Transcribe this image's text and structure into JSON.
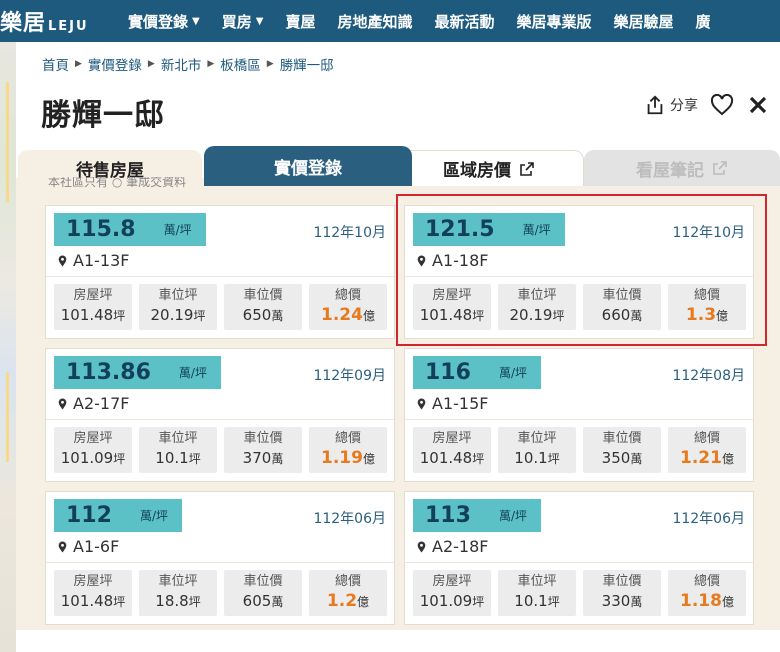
{
  "nav": {
    "logo_cn": "樂居",
    "logo_en": "LEJU",
    "items": [
      {
        "label": "實價登錄",
        "dropdown": true
      },
      {
        "label": "買房",
        "dropdown": true
      },
      {
        "label": "賣屋",
        "dropdown": false
      },
      {
        "label": "房地產知識",
        "dropdown": false
      },
      {
        "label": "最新活動",
        "dropdown": false
      },
      {
        "label": "樂居專業版",
        "dropdown": false
      },
      {
        "label": "樂居驗屋",
        "dropdown": false
      },
      {
        "label": "廣",
        "dropdown": false
      }
    ]
  },
  "breadcrumb": [
    "首頁",
    "實價登錄",
    "新北市",
    "板橋區",
    "勝輝一邸"
  ],
  "page_title": "勝輝一邸",
  "actions": {
    "share_label": "分享"
  },
  "tabs": [
    "待售房屋",
    "實價登錄",
    "區域房價",
    "看屋筆記"
  ],
  "hint_text": "本社區只有 ○ 筆成交資料",
  "stat_labels": {
    "area": "房屋坪",
    "parking_area": "車位坪",
    "parking_price": "車位價",
    "total": "總價"
  },
  "units": {
    "price": "萬/坪",
    "ping": "坪",
    "wan": "萬",
    "yi": "億"
  },
  "listings": [
    {
      "price": "115.8",
      "date": "112年10月",
      "unit": "A1-13F",
      "area": "101.48",
      "parking_area": "20.19",
      "parking_price": "650",
      "total": "1.24"
    },
    {
      "price": "121.5",
      "date": "112年10月",
      "unit": "A1-18F",
      "area": "101.48",
      "parking_area": "20.19",
      "parking_price": "660",
      "total": "1.3"
    },
    {
      "price": "113.86",
      "date": "112年09月",
      "unit": "A2-17F",
      "area": "101.09",
      "parking_area": "10.1",
      "parking_price": "370",
      "total": "1.19"
    },
    {
      "price": "116",
      "date": "112年08月",
      "unit": "A1-15F",
      "area": "101.48",
      "parking_area": "10.1",
      "parking_price": "350",
      "total": "1.21"
    },
    {
      "price": "112",
      "date": "112年06月",
      "unit": "A1-6F",
      "area": "101.48",
      "parking_area": "18.8",
      "parking_price": "605",
      "total": "1.2"
    },
    {
      "price": "113",
      "date": "112年06月",
      "unit": "A2-18F",
      "area": "101.09",
      "parking_area": "10.1",
      "parking_price": "330",
      "total": "1.18"
    }
  ],
  "colors": {
    "nav_bg": "#1d5a7e",
    "badge": "#5bc1c6",
    "total_price": "#e67a1e",
    "highlight": "#d0272e"
  }
}
